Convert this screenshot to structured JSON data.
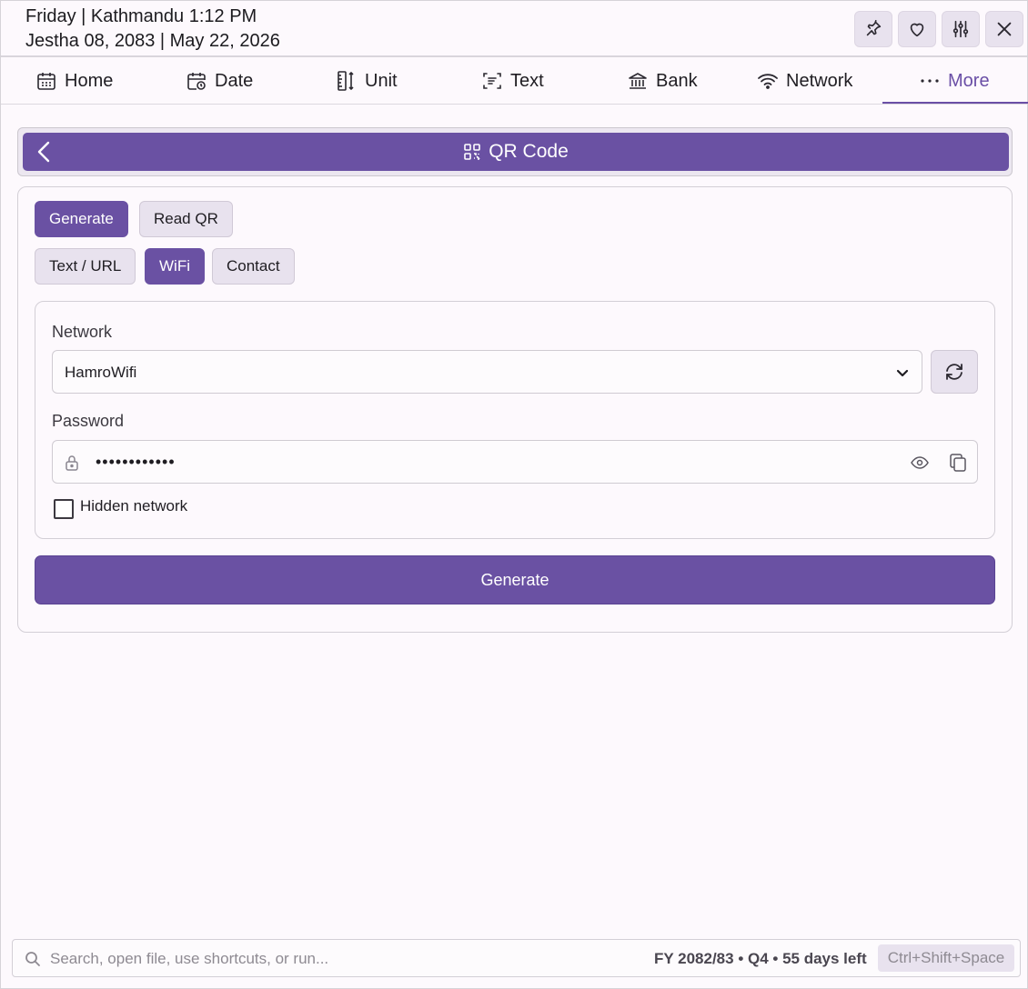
{
  "header": {
    "line1": "Friday | Kathmandu 1:12 PM",
    "line2": "Jestha 08, 2083 | May 22, 2026",
    "buttons": [
      "pin-icon",
      "heart-icon",
      "sliders-icon",
      "close-icon"
    ]
  },
  "tabs": [
    {
      "label": "Home",
      "icon": "calendar-icon"
    },
    {
      "label": "Date",
      "icon": "calendar-clock-icon"
    },
    {
      "label": "Unit",
      "icon": "ruler-icon"
    },
    {
      "label": "Text",
      "icon": "text-scan-icon"
    },
    {
      "label": "Bank",
      "icon": "bank-icon"
    },
    {
      "label": "Network",
      "icon": "wifi-icon"
    },
    {
      "label": "More",
      "icon": "more-icon"
    }
  ],
  "banner": {
    "title": "QR Code"
  },
  "modes": {
    "generate": "Generate",
    "read": "Read QR"
  },
  "types": {
    "text": "Text / URL",
    "wifi": "WiFi",
    "contact": "Contact"
  },
  "form": {
    "network_label": "Network",
    "network_value": "HamroWifi",
    "password_label": "Password",
    "password_value": "••••••••••••",
    "hidden_label": "Hidden network",
    "generate_label": "Generate"
  },
  "footer": {
    "search_placeholder": "Search, open file, use shortcuts, or run...",
    "fy_status": "FY 2082/83 • Q4 • 55 days left",
    "shortcut": "Ctrl+Shift+Space"
  },
  "colors": {
    "accent": "#6a51a3",
    "pill_bg": "#e8e2ee"
  }
}
